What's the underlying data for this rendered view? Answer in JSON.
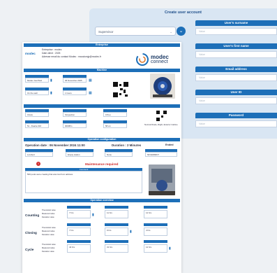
{
  "create_panel": {
    "title": "Create user account",
    "role_select": "Supervisor",
    "surname_label": "User's surname",
    "first_name_label": "User's first name",
    "email_label": "Email address",
    "userid_label": "User ID",
    "password_label": "Password",
    "placeholder": "Value"
  },
  "sheet": {
    "logo_line1": "modec",
    "logo_line2": "connect",
    "header_left": "modec",
    "enterprise_title": "Enterprise",
    "enterprise_line1": "Entreprise : modec",
    "enterprise_line2": "Date client : 2025",
    "enterprise_line3": "Adresse email du contact Modec : mcustomjp@modec.fr",
    "machine_title": "Machine",
    "machine_f1": "Modec Jour/Nuit",
    "machine_f2": "06 November 2025",
    "machine_f3": "On the wall",
    "machine_f4": "1 hours",
    "row3_f1": "Clovis",
    "row3_f2": "Kimpedron",
    "row3_f3": "0 Peu",
    "row3_f4": "58 cm",
    "row4_f1": "51 - Duarte 016",
    "row4_f2": "0000ffm",
    "row4_f3": "58 cm",
    "row4_note": "Normal Diode, Right, Exterior Cabine",
    "op_title": "Operation configuration",
    "op_date": "Operation date : 06 November 2024 11:00",
    "op_duration": "Duration : 2 Minutes",
    "op_status": "Ended",
    "op_f1": "Lorobert",
    "op_f2": "Empty station",
    "op_f3": "None",
    "op_f4": "NFCENMIO7",
    "maint_title": "Maintenance required",
    "comment_title": "Comment",
    "comment_text": "500 pools were creating that was lost from address",
    "overview_title": "Operation overview",
    "row_labels": [
      "Counting",
      "Closing",
      "Cycle"
    ],
    "ov_sublabels": [
      "Theoretical value",
      "Measured value",
      "Deviation value"
    ],
    "ov_values": [
      "7 hrs",
      "11 hrs",
      "12 hrs",
      "7 hrs",
      "9 hrs",
      "4 hrs",
      "44 hrs",
      "31 hrs",
      "12 hrs"
    ]
  }
}
